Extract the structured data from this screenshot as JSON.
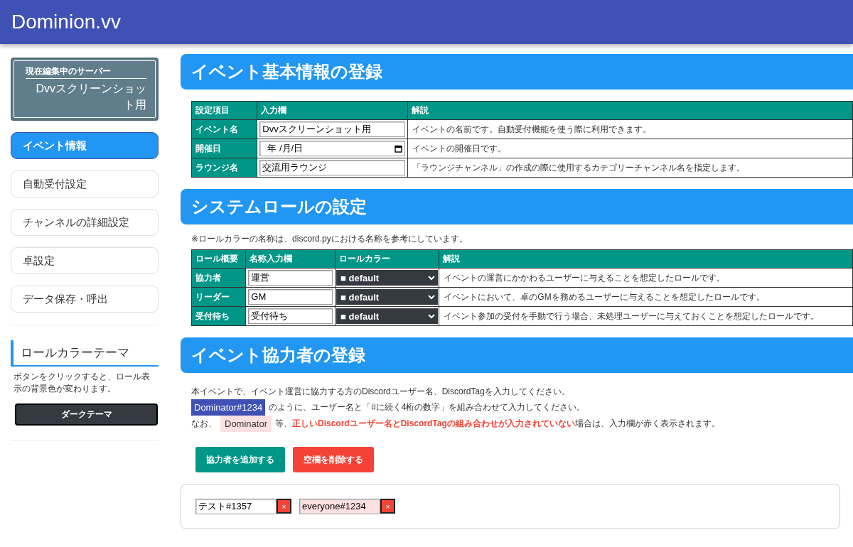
{
  "header": {
    "title": "Dominion.vv"
  },
  "sidebar": {
    "server": {
      "label": "現在編集中のサーバー",
      "name": "Dvvスクリーンショット用"
    },
    "items": [
      {
        "label": "イベント情報",
        "selected": true
      },
      {
        "label": "自動受付設定",
        "selected": false
      },
      {
        "label": "チャンネルの詳細設定",
        "selected": false
      },
      {
        "label": "卓設定",
        "selected": false
      },
      {
        "label": "データ保存・呼出",
        "selected": false
      }
    ],
    "theme": {
      "title": "ロールカラーテーマ",
      "description": "ボタンをクリックすると、ロール表示の背景色が変わります。",
      "button": "ダークテーマ"
    }
  },
  "sections": [
    {
      "kind": "basic",
      "title": "イベント基本情報の登録",
      "columns": [
        "設定項目",
        "入力欄",
        "解説"
      ],
      "rows": [
        {
          "kind": "text",
          "label": "イベント名",
          "value": "Dvvスクリーンショット用",
          "description": "イベントの名前です。自動受付機能を使う際に利用できます。"
        },
        {
          "kind": "date",
          "label": "開催日",
          "placeholder": "年 /月/日",
          "description": "イベントの開催日です。"
        },
        {
          "kind": "text",
          "label": "ラウンジ名",
          "value": "交流用ラウンジ",
          "description": "「ラウンジチャンネル」の作成の際に使用するカテゴリーチャンネル名を指定します。"
        }
      ]
    },
    {
      "kind": "roles",
      "title": "システムロールの設定",
      "note": "※ロールカラーの名称は、discord.pyにおける名称を参考にしています。",
      "columns": [
        "ロール概要",
        "名称入力欄",
        "ロールカラー",
        "解説"
      ],
      "rows": [
        {
          "label": "協力者",
          "value": "運営",
          "role_color": "■ default",
          "description": "イベントの運営にかかわるユーザーに与えることを想定したロールです。"
        },
        {
          "label": "リーダー",
          "value": "GM",
          "role_color": "■ default",
          "description": "イベントにおいて、卓のGMを務めるユーザーに与えることを想定したロールです。"
        },
        {
          "label": "受付待ち",
          "value": "受付待ち",
          "role_color": "■ default",
          "description": "イベント参加の受付を手動で行う場合、未処理ユーザーに与えておくことを想定したロールです。"
        }
      ]
    },
    {
      "kind": "collaborators",
      "title": "イベント協力者の登録",
      "intro": "本イベントで、イベント運営に協力する方のDiscordユーザー名、DiscordTagを入力してください。",
      "example_tag": "Dominator#1234",
      "example_text": "のように、ユーザー名と「#に続く4桁の数字」を組み合わせて入力してください。",
      "warning_prefix": "なお、",
      "bad_tag": "Dominator",
      "warning_text": "等、**正しいDiscordユーザー名とDiscordTagの組み合わせが入力されていない**場合は、入力欄が赤く表示されます。",
      "buttons": [
        {
          "kind": "add",
          "label": "協力者を追加する"
        },
        {
          "kind": "delete",
          "label": "空欄を削除する"
        }
      ],
      "entries": [
        {
          "value": "テスト#1357",
          "invalid": false,
          "remove": "×"
        },
        {
          "value": "everyone#1234",
          "invalid": true,
          "remove": "×"
        }
      ]
    }
  ]
}
